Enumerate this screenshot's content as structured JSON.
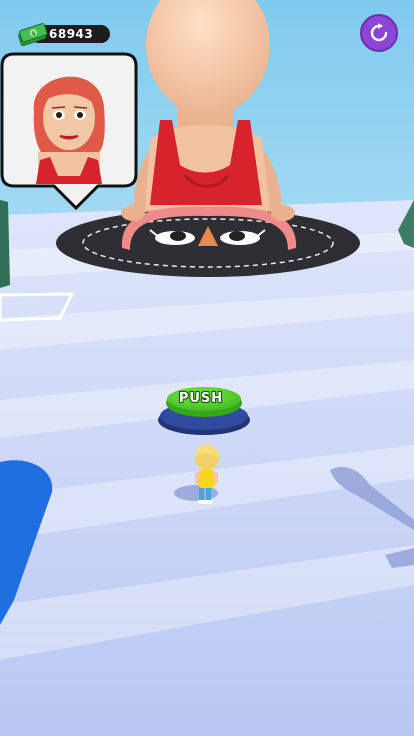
{
  "hud": {
    "cash_amount": "68943",
    "cash_icon": "cash-stack-icon",
    "restart_icon": "restart-icon"
  },
  "push_button": {
    "label": "PUSH"
  },
  "colors": {
    "floor": "#c9d4f6",
    "sky": "#8fd0ef",
    "push_button": "#56d630",
    "push_base": "#2a3f8c",
    "restart_bg": "#8b46d8",
    "top_red": "#d8232c",
    "hair_red": "#e05a4a",
    "skin": "#f2c7a5"
  }
}
